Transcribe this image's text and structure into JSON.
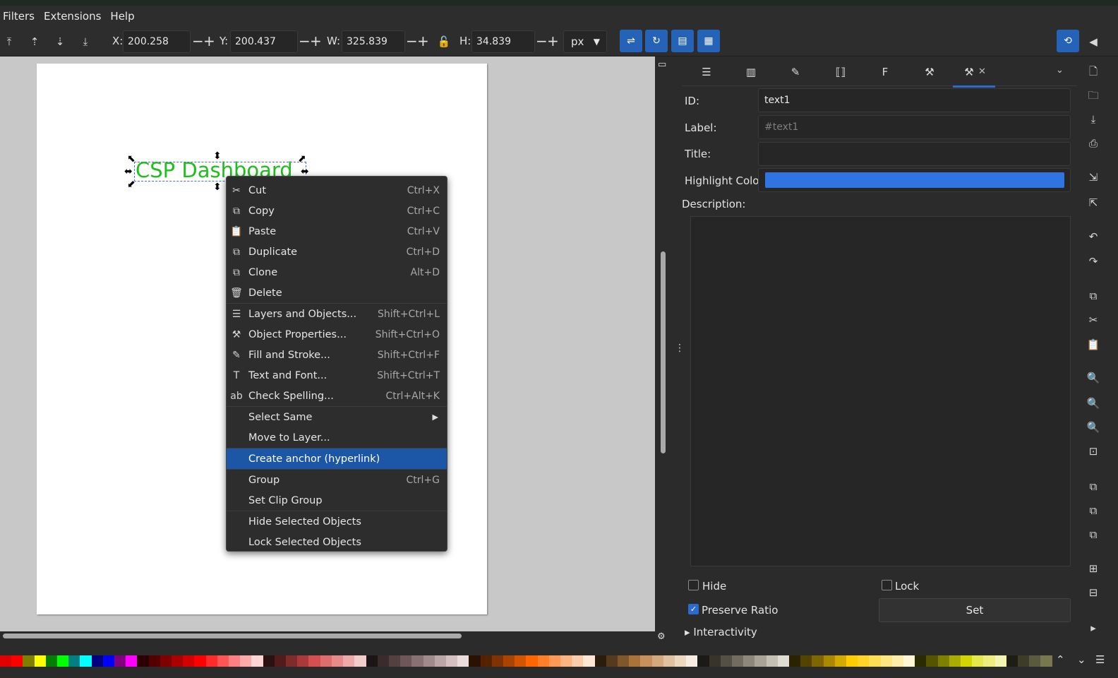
{
  "menubar": {
    "items": [
      "Filters",
      "Extensions",
      "Help"
    ]
  },
  "toolbar": {
    "x_label": "X:",
    "x_value": "200.258",
    "y_label": "Y:",
    "y_value": "200.437",
    "w_label": "W:",
    "w_value": "325.839",
    "h_label": "H:",
    "h_value": "34.839",
    "unit": "px",
    "minus": "−",
    "plus": "+"
  },
  "canvas": {
    "selected_text": "CSP Dashboard",
    "text_color": "#1fbf1f"
  },
  "context_menu": {
    "items": [
      {
        "label": "Cut",
        "shortcut": "Ctrl+X",
        "icon": "scissors-icon",
        "glyph": "✂"
      },
      {
        "label": "Copy",
        "shortcut": "Ctrl+C",
        "icon": "copy-icon",
        "glyph": "⧉"
      },
      {
        "label": "Paste",
        "shortcut": "Ctrl+V",
        "icon": "paste-icon",
        "glyph": "📋"
      },
      {
        "label": "Duplicate",
        "shortcut": "Ctrl+D",
        "icon": "duplicate-icon",
        "glyph": "⧉"
      },
      {
        "label": "Clone",
        "shortcut": "Alt+D",
        "icon": "clone-icon",
        "glyph": "⧉"
      },
      {
        "label": "Delete",
        "shortcut": "",
        "icon": "trash-icon",
        "glyph": "🗑"
      },
      {
        "label": "Layers and Objects...",
        "shortcut": "Shift+Ctrl+L",
        "icon": "layers-icon",
        "glyph": "☰"
      },
      {
        "label": "Object Properties...",
        "shortcut": "Shift+Ctrl+O",
        "icon": "wrench-icon",
        "glyph": "⚒"
      },
      {
        "label": "Fill and Stroke...",
        "shortcut": "Shift+Ctrl+F",
        "icon": "brush-icon",
        "glyph": "✎"
      },
      {
        "label": "Text and Font...",
        "shortcut": "Shift+Ctrl+T",
        "icon": "text-icon",
        "glyph": "T"
      },
      {
        "label": "Check Spelling...",
        "shortcut": "Ctrl+Alt+K",
        "icon": "spellcheck-icon",
        "glyph": "ab"
      },
      {
        "label": "Select Same",
        "shortcut": "",
        "icon": "",
        "glyph": "",
        "submenu": "▶"
      },
      {
        "label": "Move to Layer...",
        "shortcut": "",
        "icon": "",
        "glyph": ""
      },
      {
        "label": "Create anchor (hyperlink)",
        "shortcut": "",
        "icon": "",
        "glyph": ""
      },
      {
        "label": "Group",
        "shortcut": "Ctrl+G",
        "icon": "",
        "glyph": ""
      },
      {
        "label": "Set Clip Group",
        "shortcut": "",
        "icon": "",
        "glyph": ""
      },
      {
        "label": "Hide Selected Objects",
        "shortcut": "",
        "icon": "",
        "glyph": ""
      },
      {
        "label": "Lock Selected Objects",
        "shortcut": "",
        "icon": "",
        "glyph": ""
      }
    ],
    "highlighted": "Create anchor (hyperlink)"
  },
  "properties": {
    "id_label": "ID:",
    "id_value": "text1",
    "label_label": "Label:",
    "label_placeholder": "#text1",
    "title_label": "Title:",
    "title_value": "",
    "highlight_label": "Highlight Color:",
    "highlight_color": "#2f74e0",
    "description_label": "Description:",
    "hide_label": "Hide",
    "lock_label": "Lock",
    "preserve_ratio_label": "Preserve Ratio",
    "preserve_ratio_checked": true,
    "set_button": "Set",
    "interactivity_label": "Interactivity"
  },
  "colors": {
    "accent": "#2d6ad0",
    "menu_highlight": "#1c56a6"
  },
  "palette": [
    "#e00000",
    "#ff0000",
    "#808000",
    "#ffff00",
    "#008000",
    "#00ff00",
    "#008080",
    "#00ffff",
    "#000080",
    "#0000ff",
    "#800080",
    "#ff00ff",
    "#2a0000",
    "#550000",
    "#800000",
    "#aa0000",
    "#d40000",
    "#ff0000",
    "#ff2a2a",
    "#ff5555",
    "#ff8080",
    "#ffaaaa",
    "#ffd5d5",
    "#2b1111",
    "#551a1a",
    "#802b2b",
    "#aa3939",
    "#d45050",
    "#e06d6d",
    "#e68a8a",
    "#eeaaaa",
    "#f4cccc",
    "#1c1515",
    "#3a2c2c",
    "#554040",
    "#6f5757",
    "#8a7070",
    "#a38a8a",
    "#bba5a5",
    "#d4c0c0",
    "#ecdddd",
    "#2b1100",
    "#552200",
    "#803300",
    "#aa4400",
    "#d45500",
    "#ff6600",
    "#ff7f2a",
    "#ff9955",
    "#ffb380",
    "#ffccaa",
    "#ffe6d5",
    "#2b1d0e",
    "#553a1d",
    "#80572b",
    "#aa7439",
    "#c8915c",
    "#d4aa7d",
    "#e0c39e",
    "#ecd8be",
    "#f6ecdf",
    "#1c1a16",
    "#38342c",
    "#545046",
    "#706c60",
    "#8c877a",
    "#a8a396",
    "#c4c0b4",
    "#e0ddd4",
    "#2b2200",
    "#554400",
    "#806600",
    "#aa8800",
    "#d4aa00",
    "#ffcc00",
    "#ffd42a",
    "#ffdd55",
    "#ffe680",
    "#ffeeaa",
    "#fff6d5",
    "#2b2b00",
    "#555500",
    "#808000",
    "#aaaa00",
    "#d4d400",
    "#e6e64d",
    "#eeee80",
    "#f5f5b3",
    "#1e1e14",
    "#3c3c28",
    "#5a5a3c",
    "#787850"
  ]
}
